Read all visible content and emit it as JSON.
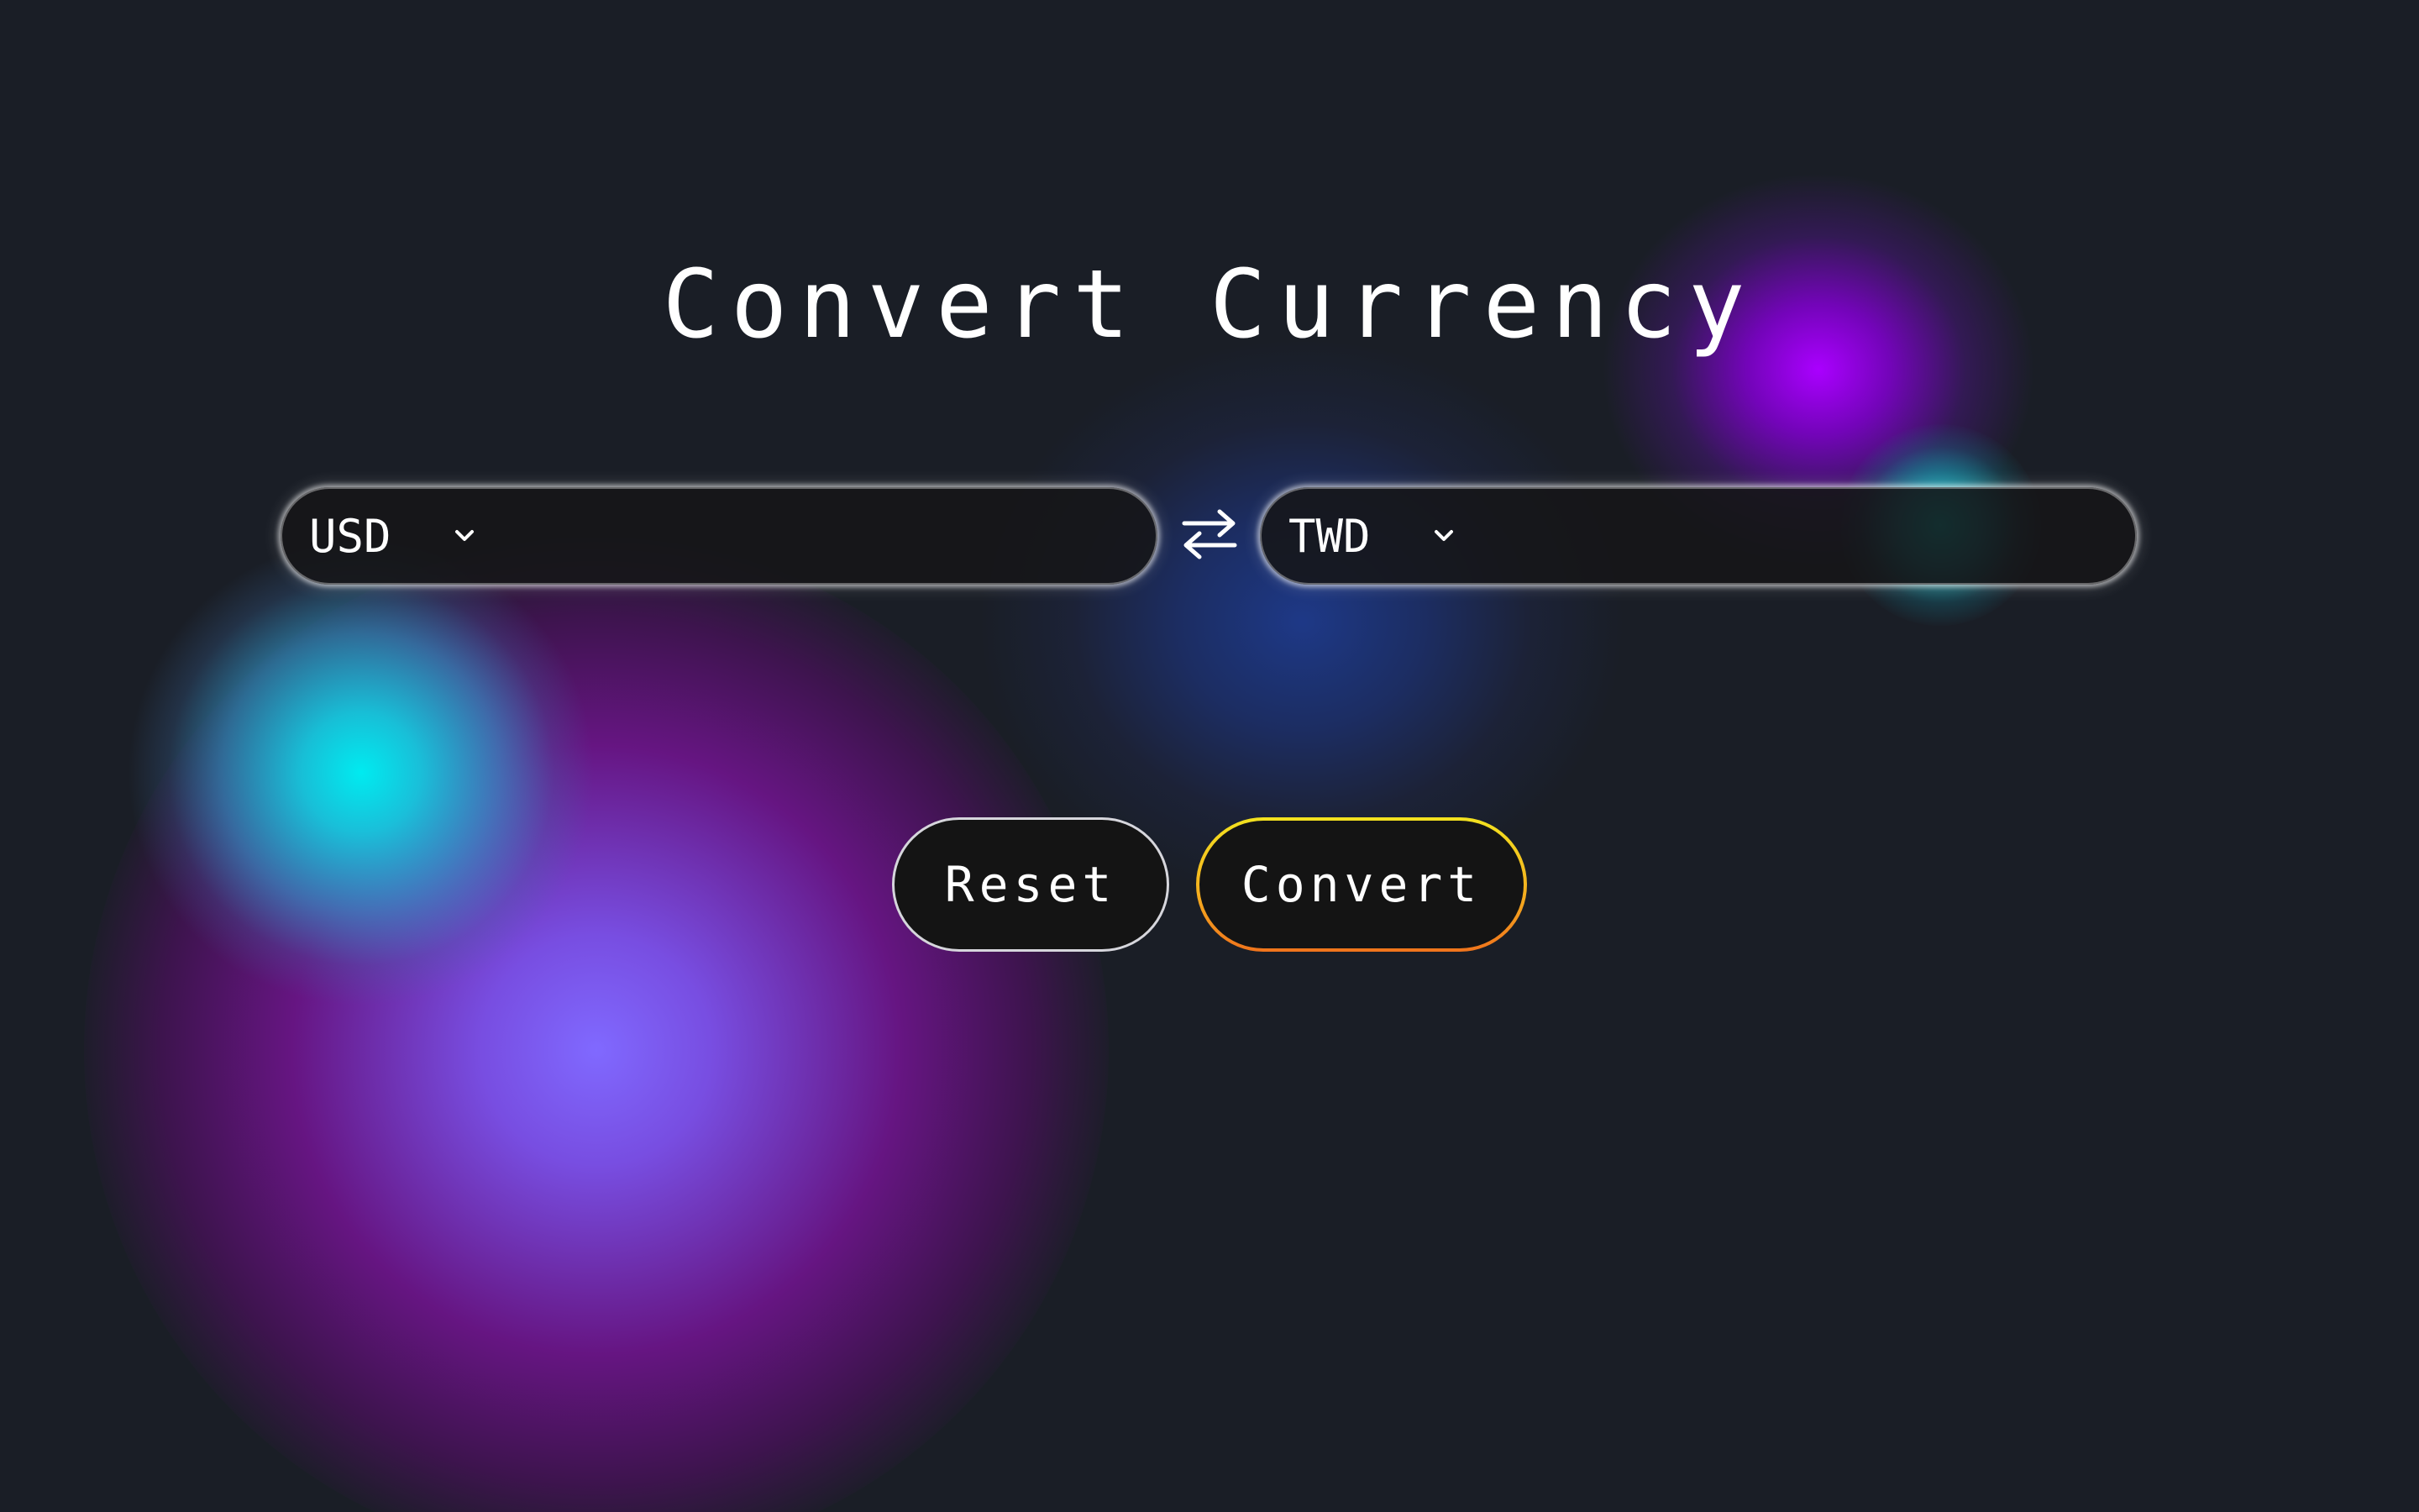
{
  "page": {
    "title": "Convert Currency"
  },
  "converter": {
    "from": {
      "currency": "USD",
      "amount": "",
      "amount_placeholder": ""
    },
    "to": {
      "currency": "TWD",
      "amount": "",
      "amount_placeholder": ""
    },
    "swap_icon": "swap-arrows-icon",
    "chevron_icon": "chevron-down-icon"
  },
  "actions": {
    "reset_label": "Reset",
    "convert_label": "Convert"
  },
  "colors": {
    "background": "#1a1e26",
    "text": "#ffffff",
    "pill_fill": "#161618",
    "convert_border_top": "#f3e21f",
    "convert_border_bottom": "#f0741c",
    "reset_border": "#d6d6dc"
  }
}
